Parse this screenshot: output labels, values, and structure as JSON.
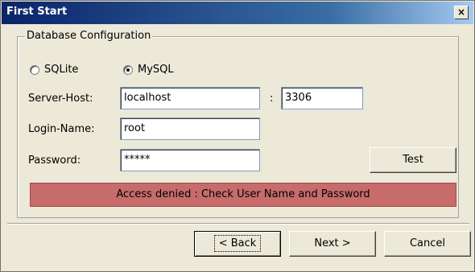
{
  "window": {
    "title": "First Start",
    "close_glyph": "×"
  },
  "group": {
    "legend": "Database Configuration"
  },
  "db_type": {
    "options": [
      {
        "label": "SQLite",
        "selected": false
      },
      {
        "label": "MySQL",
        "selected": true
      }
    ]
  },
  "form": {
    "server_host_label": "Server-Host:",
    "server_host_value": "localhost",
    "port_separator": ":",
    "port_value": "3306",
    "login_label": "Login-Name:",
    "login_value": "root",
    "password_label": "Password:",
    "password_value": "*****",
    "test_label": "Test"
  },
  "status": {
    "message": "Access denied : Check User Name and Password",
    "color": "#c86b6b"
  },
  "footer": {
    "back_label": "< Back",
    "next_label": "Next >",
    "cancel_label": "Cancel"
  }
}
